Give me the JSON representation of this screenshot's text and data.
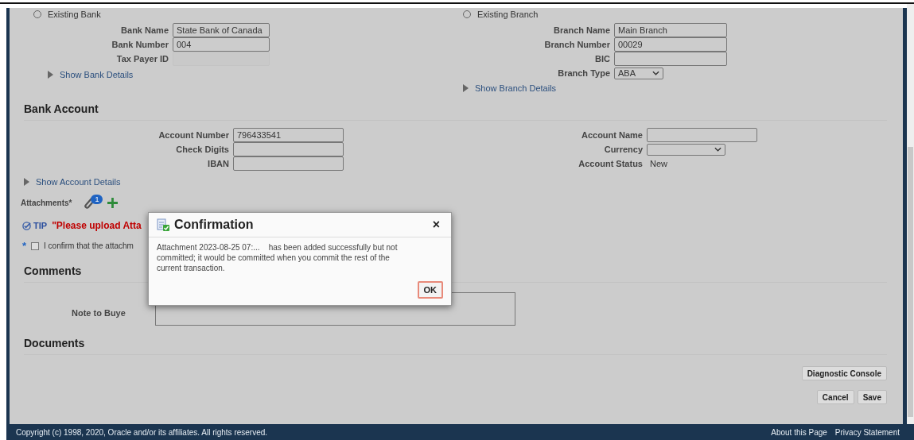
{
  "bank": {
    "radio": {
      "label": "Existing Bank",
      "selected": false
    },
    "fields": [
      {
        "label": "Bank Name",
        "value": "State Bank of Canada",
        "kind": "text"
      },
      {
        "label": "Bank Number",
        "value": "004",
        "kind": "text"
      },
      {
        "label": "Tax Payer ID",
        "kind": "readonly"
      }
    ],
    "details_link": "Show Bank Details"
  },
  "branch": {
    "radio": {
      "label": "Existing Branch",
      "selected": false
    },
    "fields": [
      {
        "label": "Branch Name",
        "value": "Main Branch",
        "kind": "text"
      },
      {
        "label": "Branch Number",
        "value": "00029",
        "kind": "text"
      },
      {
        "label": "BIC",
        "kind": "text"
      },
      {
        "label": "Branch Type",
        "value": "ABA",
        "kind": "select"
      }
    ],
    "details_link": "Show Branch Details"
  },
  "bank_account": {
    "title": "Bank Account",
    "left_fields": [
      {
        "label": "Account Number",
        "value": "796433541",
        "kind": "text"
      },
      {
        "label": "Check Digits",
        "kind": "text"
      },
      {
        "label": "IBAN",
        "kind": "text"
      }
    ],
    "right_fields": [
      {
        "label": "Account Name",
        "kind": "text"
      },
      {
        "label": "Currency",
        "kind": "select"
      },
      {
        "label": "Account Status",
        "value": "New",
        "kind": "value"
      }
    ],
    "details_link": "Show Account Details"
  },
  "attachments": {
    "label": "Attachments*",
    "count": "1"
  },
  "tip": {
    "label": "TIP",
    "message": "\"Please upload Atta"
  },
  "confirm": {
    "required_mark": "*",
    "label": "I confirm that the attachm",
    "checked": false
  },
  "comments": {
    "title": "Comments",
    "note_label": "Note to Buye"
  },
  "documents": {
    "title": "Documents"
  },
  "console_button": "Diagnostic Console",
  "form_buttons": [
    "Cancel",
    "Save"
  ],
  "footer": {
    "copyright": "Copyright (c) 1998, 2020, Oracle and/or its affiliates. All rights reserved.",
    "links": [
      "About this Page",
      "Privacy Statement"
    ]
  },
  "dialog": {
    "title": "Confirmation",
    "close": "×",
    "message": "Attachment 2023-08-25 07:...    has been added successfully but not committed; it would be committed when you commit the rest of the current transaction.",
    "button": "OK"
  }
}
